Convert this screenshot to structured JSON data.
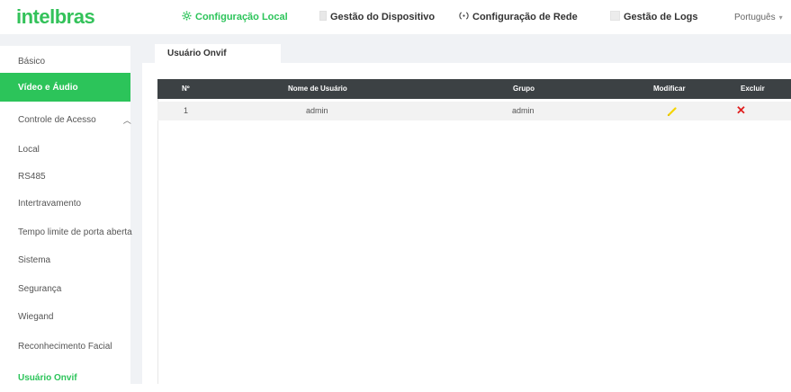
{
  "brand": {
    "logo": "intelbras"
  },
  "nav": {
    "items": [
      {
        "label": "Configuração Local",
        "icon": "gear-icon",
        "active": true
      },
      {
        "label": "Gestão do Dispositivo",
        "icon": "device-icon",
        "active": false
      },
      {
        "label": "Configuração de Rede",
        "icon": "network-icon",
        "active": false
      },
      {
        "label": "Gestão de Logs",
        "icon": "logs-icon",
        "active": false
      }
    ],
    "language": "Português"
  },
  "sidebar": {
    "items": [
      {
        "label": "Básico"
      },
      {
        "label": "Vídeo e Áudio"
      },
      {
        "label": "Controle de Acesso"
      },
      {
        "label": "Local"
      },
      {
        "label": "RS485"
      },
      {
        "label": "Intertravamento"
      },
      {
        "label": "Tempo limite de porta aberta"
      },
      {
        "label": "Sistema"
      },
      {
        "label": "Segurança"
      },
      {
        "label": "Wiegand"
      },
      {
        "label": "Reconhecimento Facial"
      },
      {
        "label": "Usuário Onvif"
      }
    ]
  },
  "tab": {
    "label": "Usuário Onvif"
  },
  "table": {
    "headers": [
      "Nº",
      "Nome de Usuário",
      "Grupo",
      "Modificar",
      "Excluir"
    ],
    "rows": [
      {
        "no": "1",
        "username": "admin",
        "group": "admin"
      }
    ]
  },
  "colors": {
    "accent": "#2cc45a",
    "header": "#3c4144",
    "delete": "#e02020",
    "edit": "#f5d400"
  }
}
